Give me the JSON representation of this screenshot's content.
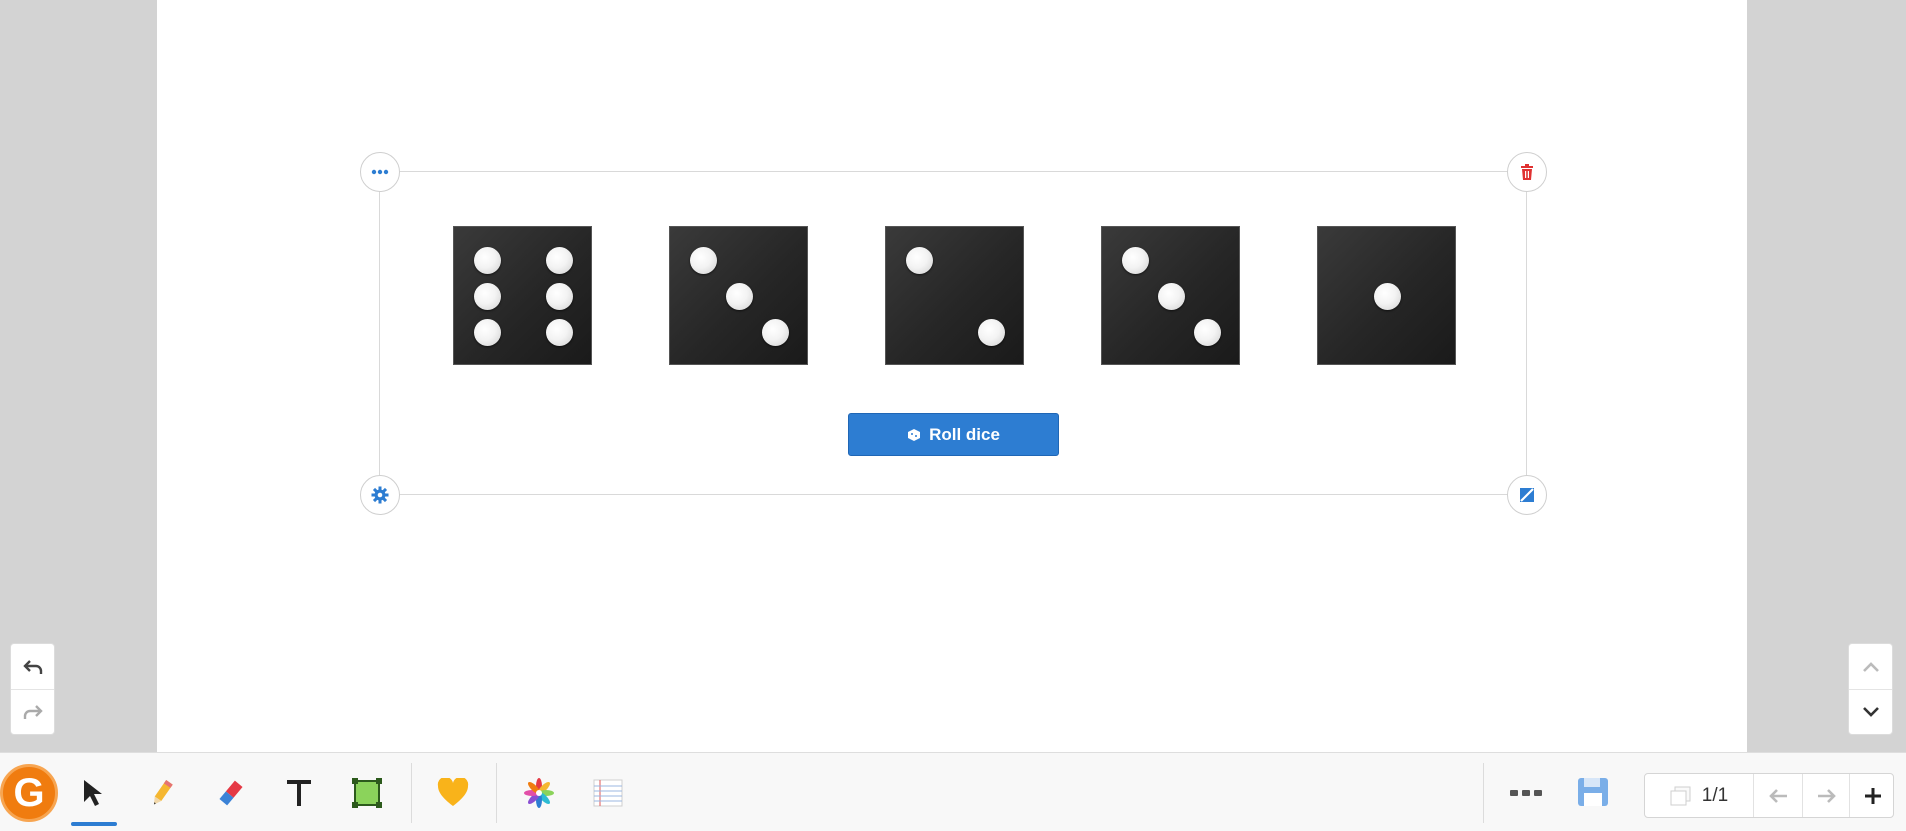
{
  "widget": {
    "roll_button_label": "Roll dice",
    "dice": [
      6,
      3,
      2,
      3,
      1
    ]
  },
  "pager": {
    "page_indicator": "1/1"
  },
  "toolbar": {
    "logo_letter": "G",
    "tools": [
      "select-tool",
      "pen-tool",
      "eraser-tool",
      "text-tool",
      "shape-tool",
      "stickers-tool",
      "apps-tool",
      "background-tool"
    ],
    "active_tool": "select-tool"
  },
  "colors": {
    "accent": "#2d7dd2",
    "delete": "#e03131",
    "logo": "#f07c0f",
    "die": "#2b2b2b"
  }
}
